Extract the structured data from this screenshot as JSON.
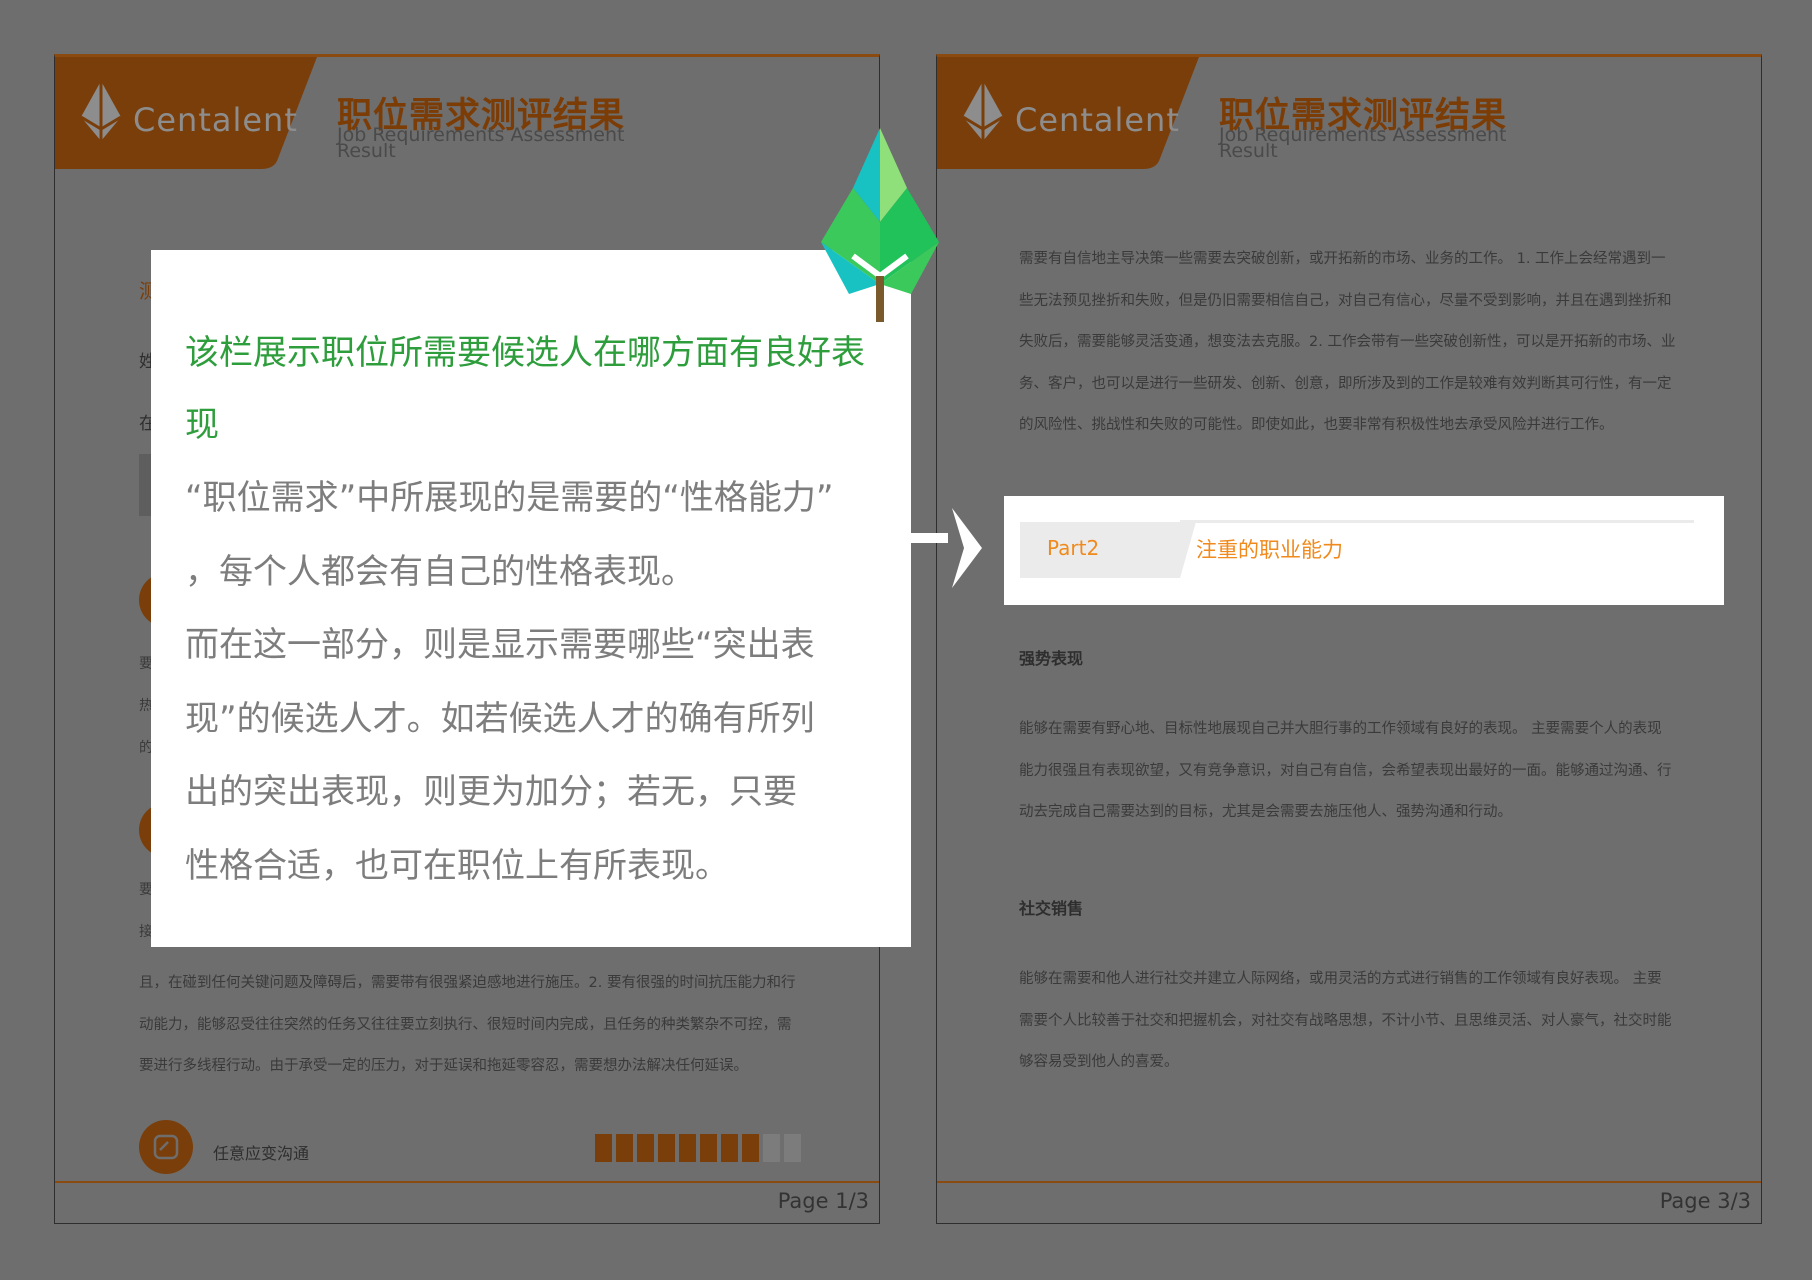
{
  "brand": {
    "name": "Centalent"
  },
  "header": {
    "title": "职位需求测评结果",
    "subtitle": "Job Requirements Assessment Result"
  },
  "left_page": {
    "frag_a": "测",
    "frag_b": "姓",
    "frag_c": "在",
    "frag_d": "要",
    "frag_e": "热",
    "frag_f": "的",
    "frag_g": "要",
    "frag_h": "接",
    "lines": [
      "且，在碰到任何关键问题及障碍后，需要带有很强紧迫感地进行施压。2. 要有很强的时间抗压能力和行",
      "动能力，能够忍受往往突然的任务又往往要立刻执行、很短时间内完成，且任务的种类繁杂不可控，需",
      "要进行多线程行动。由于承受一定的压力，对于延误和拖延零容忍，需要想办法解决任何延误。"
    ],
    "skill_label": "任意应变沟通",
    "skill_level": 0.8,
    "page": "Page 1/3"
  },
  "right_page": {
    "intro_lines": [
      "需要有自信地主导决策一些需要去突破创新，或开拓新的市场、业务的工作。 1. 工作上会经常遇到一",
      "些无法预见挫折和失败，但是仍旧需要相信自己，对自己有信心，尽量不受到影响，并且在遇到挫折和",
      "失败后，需要能够灵活变通，想变法去克服。2. 工作会带有一些突破创新性，可以是开拓新的市场、业",
      "务、客户，也可以是进行一些研发、创新、创意，即所涉及到的工作是较难有效判断其可行性，有一定",
      "的风险性、挑战性和失败的可能性。即使如此，也要非常有积极性地去承受风险并进行工作。"
    ],
    "part_label": "Part2",
    "part_title": "注重的职业能力",
    "section1_title": "强势表现",
    "section1_lines": [
      "能够在需要有野心地、目标性地展现自己并大胆行事的工作领域有良好的表现。 主要需要个人的表现",
      "能力很强且有表现欲望，又有竞争意识，对自己有自信，会希望表现出最好的一面。能够通过沟通、行",
      "动去完成自己需要达到的目标，尤其是会需要去施压他人、强势沟通和行动。"
    ],
    "section2_title": "社交销售",
    "section2_lines": [
      "能够在需要和他人进行社交并建立人际网络，或用灵活的方式进行销售的工作领域有良好表现。 主要",
      "需要个人比较善于社交和把握机会，对社交有战略思想，不计小节、且思维灵活、对人豪气，社交时能",
      "够容易受到他人的喜爱。"
    ],
    "page": "Page 3/3"
  },
  "callout": {
    "title": "该栏展示职位所需要候选人在哪方面有良好表现",
    "body_lines": [
      "“职位需求”中所展现的是需要的“性格能力”",
      "，每个人都会有自己的性格表现。",
      "而在这一部分，则是显示需要哪些“突出表",
      "现”的候选人才。如若候选人才的确有所列",
      "出的突出表现，则更为加分；若无，只要",
      "性格合适，也可在职位上有所表现。"
    ]
  },
  "colors": {
    "brand_orange": "#f08a1c",
    "brand_brown": "#7a3e0a",
    "callout_green": "#2e9d3c",
    "overlay_gray": "#6e6e6e"
  }
}
